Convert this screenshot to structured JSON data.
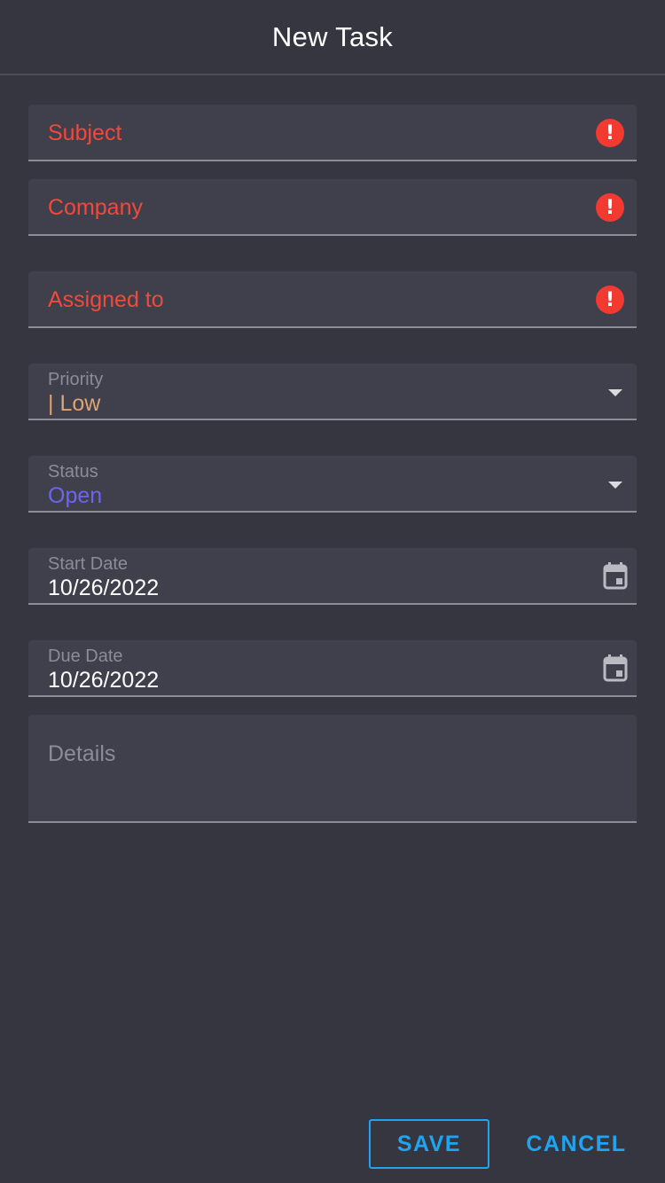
{
  "header": {
    "title": "New Task"
  },
  "fields": {
    "subject": {
      "label": "Subject"
    },
    "company": {
      "label": "Company"
    },
    "assigned_to": {
      "label": "Assigned to"
    },
    "priority": {
      "label": "Priority",
      "value": "| Low",
      "value_color": "#e0a374"
    },
    "status": {
      "label": "Status",
      "value": "Open",
      "value_color": "#6b66f0"
    },
    "start_date": {
      "label": "Start Date",
      "value": "10/26/2022"
    },
    "due_date": {
      "label": "Due Date",
      "value": "10/26/2022"
    },
    "details": {
      "placeholder": "Details"
    }
  },
  "icons": {
    "error": "exclamation-circle-icon",
    "dropdown": "caret-down-icon",
    "calendar": "calendar-icon"
  },
  "actions": {
    "save_label": "SAVE",
    "cancel_label": "CANCEL"
  },
  "colors": {
    "background": "#353640",
    "field_background": "#3f404b",
    "error": "#f2493c",
    "accent": "#1fa4f0"
  }
}
